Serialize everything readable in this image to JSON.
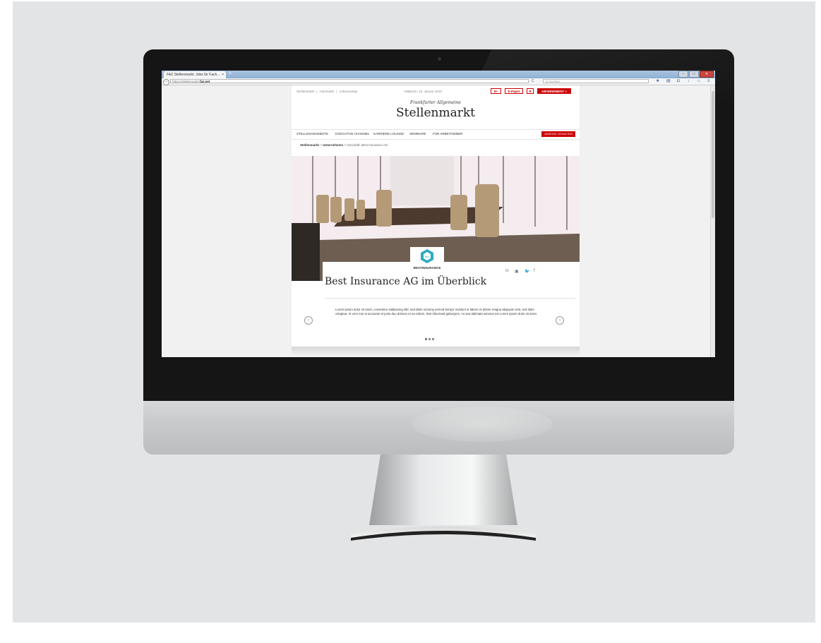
{
  "browser": {
    "tab_title": "FAZ Stellenmarkt: Jobs für Fach...",
    "tab_close": "×",
    "new_tab": "+",
    "url_prefix": "https://stellenmarkt.",
    "url_domain": "faz.net",
    "reload": "C",
    "search_placeholder": "Q Suchen",
    "window_buttons": [
      "–",
      "□",
      "✕"
    ]
  },
  "page": {
    "top_links": [
      "Stellenmarkt",
      "|",
      "Automarkt",
      "|",
      "Lebenswege"
    ],
    "date": "Mittwoch, 10. Januar 2018",
    "buttons": {
      "gplus": "8+",
      "epaper": "E-Paper",
      "rss": "R",
      "subscribe": "ABONNEMENT »"
    },
    "logo_small": "Frankfurter Allgemeine",
    "logo_big": "Stellenmarkt",
    "nav": [
      "STELLENANGEBOTE",
      "EXECUTIVE CHANNEL",
      "KARRIERE LOUNGE",
      "SEMINARE",
      "FÜR ARBEITGEBER"
    ],
    "nav_cta": "ANZEIGE SCHALTEN",
    "breadcrumb": {
      "home": "Stellenmarkt",
      "sep": ">",
      "section": "Unternehmen",
      "current": "Geschäft: Best Insurance AG"
    },
    "company": {
      "logo_mark": "BiA",
      "logo_text": "BESTINSURANCE",
      "title": "Best Insurance AG im Überblick",
      "social": [
        "in",
        "▣",
        "🐦",
        "f"
      ],
      "body": "Lorem ipsum dolor sit amet, consetetur sadipscing elitr, sed diam nonumy eirmod tempor invidunt ut labore et dolore magna aliquyam erat, sed diam voluptua. At vero eos et accusam et justo duo dolores et ea rebum. Stet clita kasd gubergren, no sea takimata sanctus est Lorem ipsum dolor sit amet.",
      "prev": "‹",
      "next": "›",
      "slides": 3,
      "active_slide": 1
    }
  }
}
